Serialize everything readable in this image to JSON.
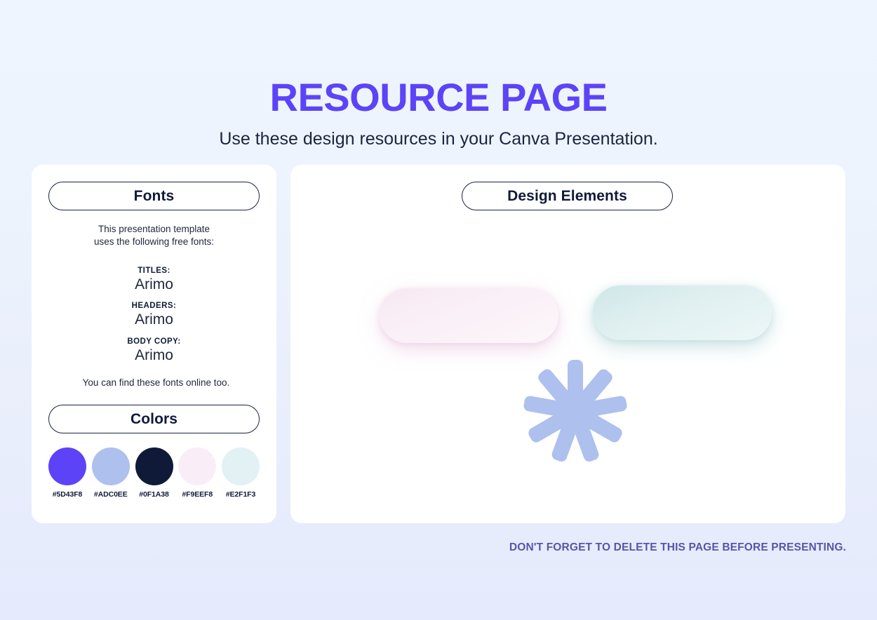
{
  "header": {
    "title": "RESOURCE PAGE",
    "subtitle": "Use these design resources in your Canva Presentation."
  },
  "fonts_panel": {
    "heading": "Fonts",
    "intro_line1": "This presentation template",
    "intro_line2": "uses the following free fonts:",
    "groups": [
      {
        "label": "TITLES:",
        "value": "Arimo"
      },
      {
        "label": "HEADERS:",
        "value": "Arimo"
      },
      {
        "label": "BODY COPY:",
        "value": "Arimo"
      }
    ],
    "footer_note": "You can find these fonts online too."
  },
  "colors_panel": {
    "heading": "Colors",
    "swatches": [
      {
        "hex": "#5D43F8",
        "label": "#5D43F8"
      },
      {
        "hex": "#ADC0EE",
        "label": "#ADC0EE"
      },
      {
        "hex": "#0F1A38",
        "label": "#0F1A38"
      },
      {
        "hex": "#F9EEF8",
        "label": "#F9EEF8"
      },
      {
        "hex": "#E2F1F3",
        "label": "#E2F1F3"
      }
    ]
  },
  "elements_panel": {
    "heading": "Design Elements",
    "shapes": [
      {
        "name": "rounded-pill-pink",
        "color": "#F9EEF8"
      },
      {
        "name": "rounded-pill-teal",
        "color": "#E2F1F3"
      },
      {
        "name": "asterisk-burst",
        "color": "#ADC0EE",
        "points": 9
      }
    ]
  },
  "footer": {
    "note": "DON'T FORGET TO DELETE THIS PAGE BEFORE PRESENTING."
  },
  "theme": {
    "brand_purple": "#5D43F8",
    "ink_navy": "#0F1A38",
    "footer_purple": "#5B54A8",
    "bg_top": "#EEF5FE",
    "bg_bottom": "#E5EAFD",
    "card_bg": "#FFFFFF"
  }
}
